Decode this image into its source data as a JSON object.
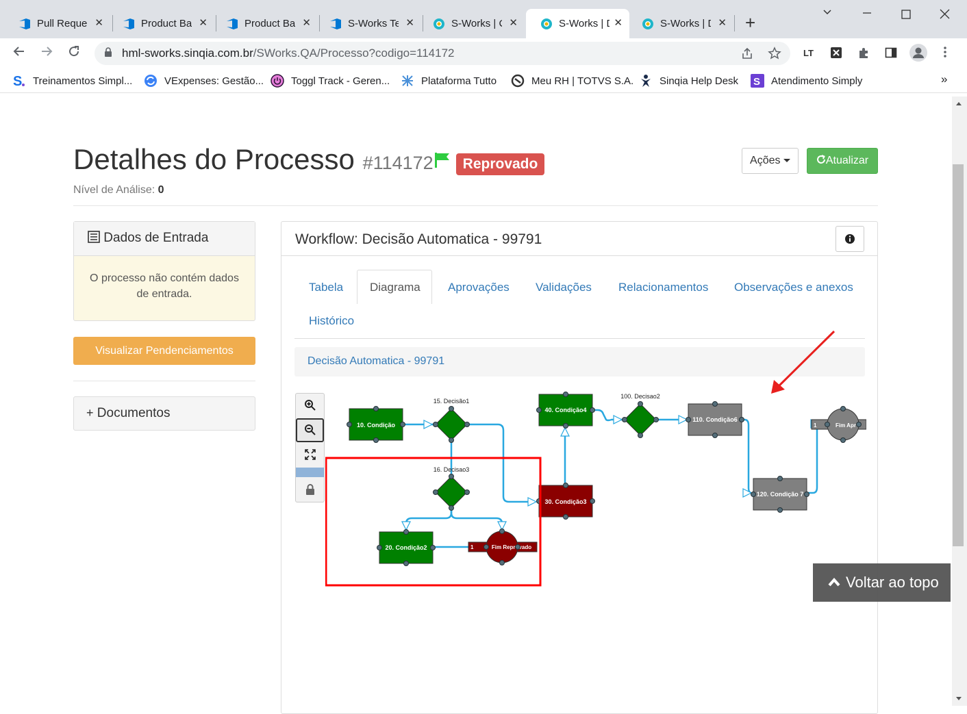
{
  "browser": {
    "tabs": [
      {
        "label": "Pull Reque",
        "icon": "azure-devops-icon"
      },
      {
        "label": "Product Ba",
        "icon": "azure-devops-icon"
      },
      {
        "label": "Product Ba",
        "icon": "azure-devops-icon"
      },
      {
        "label": "S-Works Te",
        "icon": "azure-devops-icon"
      },
      {
        "label": "S-Works | C",
        "icon": "sworks-icon"
      },
      {
        "label": "S-Works | D",
        "icon": "sworks-icon"
      },
      {
        "label": "S-Works | D",
        "icon": "sworks-icon"
      }
    ],
    "url_host": "hml-sworks.sinqia.com.br",
    "url_path": "/SWorks.QA/Processo?codigo=114172",
    "bookmarks": [
      "Treinamentos Simpl...",
      "VExpenses: Gestão...",
      "Toggl Track - Geren...",
      "Plataforma Tutto",
      "Meu RH | TOTVS S.A.",
      "Sinqia Help Desk",
      "Atendimento Simply"
    ],
    "bookmarks_more": "»"
  },
  "page": {
    "title": "Detalhes do Processo",
    "process_id": "#114172",
    "status_badge": "Reprovado",
    "nivel_label": "Nível de Análise:",
    "nivel_value": "0",
    "acoes_label": "Ações",
    "atualizar_label": "Atualizar",
    "entrada_title": "Dados de Entrada",
    "entrada_body": "O processo não contém dados de entrada.",
    "pendenciamentos_label": "Visualizar Pendenciamentos",
    "documentos_label": "Documentos"
  },
  "workflow": {
    "title": "Workflow: Decisão Automatica - 99791",
    "tabs": [
      "Tabela",
      "Diagrama",
      "Aprovações",
      "Validações",
      "Relacionamentos",
      "Observações e anexos",
      "Histórico"
    ],
    "active_tab": "Diagrama",
    "breadcrumb": "Decisão Automatica - 99791",
    "nodes": {
      "n10": "10. Condição",
      "n15": "15. Decisão1",
      "n16": "16. Decisao3",
      "n20": "20. Condição2",
      "fimrep": "Fim Reprovado",
      "fimrep_prefix": "1",
      "n30": "30. Condição3",
      "n40": "40. Condição4",
      "n100": "100. Decisao2",
      "n110": "110. Condição6",
      "n120": "120. Condição 7",
      "fimapr": "Fim Apr",
      "fimapr_prefix": "1"
    }
  },
  "colors": {
    "green": "#008000",
    "dark_red": "#8b0000",
    "gray_node": "#808080",
    "link_blue": "#29a8e0",
    "status_red": "#d9534f",
    "highlight_red": "#ff0000"
  },
  "voltar_label": "Voltar ao topo"
}
